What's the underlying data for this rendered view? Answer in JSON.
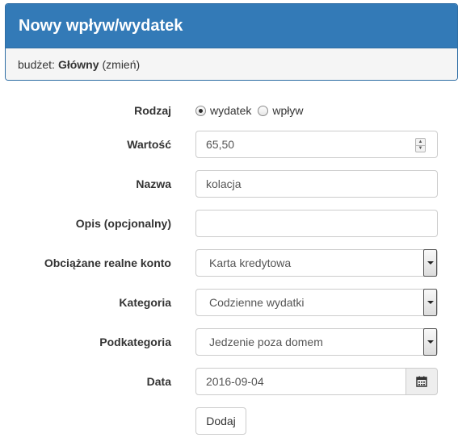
{
  "header": {
    "title": "Nowy wpływ/wydatek",
    "budget_prefix": "budżet:",
    "budget_name": "Główny",
    "budget_change": "(zmień)"
  },
  "form": {
    "type": {
      "label": "Rodzaj",
      "options": [
        "wydatek",
        "wpływ"
      ],
      "selected": "wydatek"
    },
    "value": {
      "label": "Wartość",
      "value": "65,50"
    },
    "name": {
      "label": "Nazwa",
      "value": "kolacja"
    },
    "description": {
      "label": "Opis (opcjonalny)",
      "value": ""
    },
    "account": {
      "label": "Obciążane realne konto",
      "value": "Karta kredytowa"
    },
    "category": {
      "label": "Kategoria",
      "value": "Codzienne wydatki"
    },
    "subcategory": {
      "label": "Podkategoria",
      "value": "Jedzenie poza domem"
    },
    "date": {
      "label": "Data",
      "value": "2016-09-04"
    },
    "submit_label": "Dodaj"
  },
  "icons": {
    "date": "calendar-icon",
    "select": "dropdown-arrow-icon",
    "spinner": "spinner-icon"
  },
  "colors": {
    "header_bg": "#337ab7",
    "header_text": "#ffffff",
    "subheader_bg": "#f5f5f5"
  }
}
